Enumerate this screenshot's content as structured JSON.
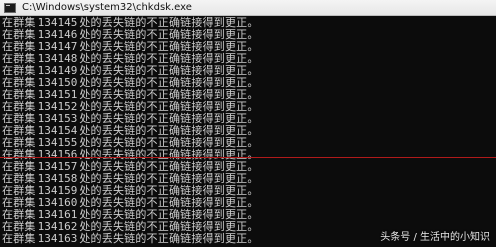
{
  "window": {
    "title": "C:\\Windows\\system32\\chkdsk.exe",
    "icon": "console-icon"
  },
  "console": {
    "prefix": "在群集",
    "suffix": "处的丢失链的不正确链接得到更正。",
    "lines": [
      "134145",
      "134146",
      "134147",
      "134148",
      "134149",
      "134150",
      "134151",
      "134152",
      "134153",
      "134154",
      "134155",
      "134156",
      "134157",
      "134158",
      "134159",
      "134160",
      "134161",
      "134162",
      "134163"
    ]
  },
  "watermark": "头条号 / 生活中的小知识"
}
